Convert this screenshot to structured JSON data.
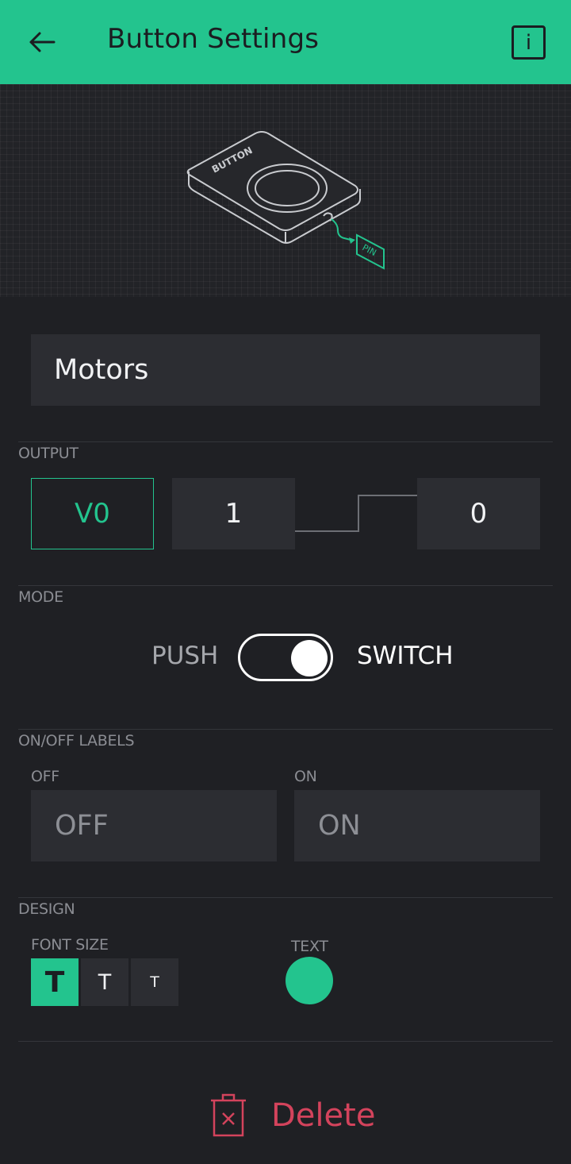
{
  "header": {
    "title": "Button Settings",
    "back_icon": "arrow-left-icon",
    "info_label": "i",
    "background": "#23c48e"
  },
  "hero": {
    "device_label": "BUTTON",
    "pin_label": "PIN"
  },
  "name_field": {
    "value": "Motors"
  },
  "output": {
    "section_label": "OUTPUT",
    "pin": "V0",
    "on_value": "1",
    "off_value": "0"
  },
  "mode": {
    "section_label": "MODE",
    "option_left": "PUSH",
    "option_right": "SWITCH",
    "selected": "SWITCH"
  },
  "labels": {
    "section_label": "ON/OFF LABELS",
    "off_label": "OFF",
    "off_placeholder": "OFF",
    "on_label": "ON",
    "on_placeholder": "ON"
  },
  "design": {
    "section_label": "DESIGN",
    "font_size_label": "FONT SIZE",
    "font_sizes": [
      "T",
      "T",
      "T"
    ],
    "selected_font_size_index": 0,
    "text_label": "TEXT",
    "text_color": "#23c48e"
  },
  "footer": {
    "delete_label": "Delete",
    "delete_icon": "trash-icon",
    "delete_color": "#d3435c"
  }
}
